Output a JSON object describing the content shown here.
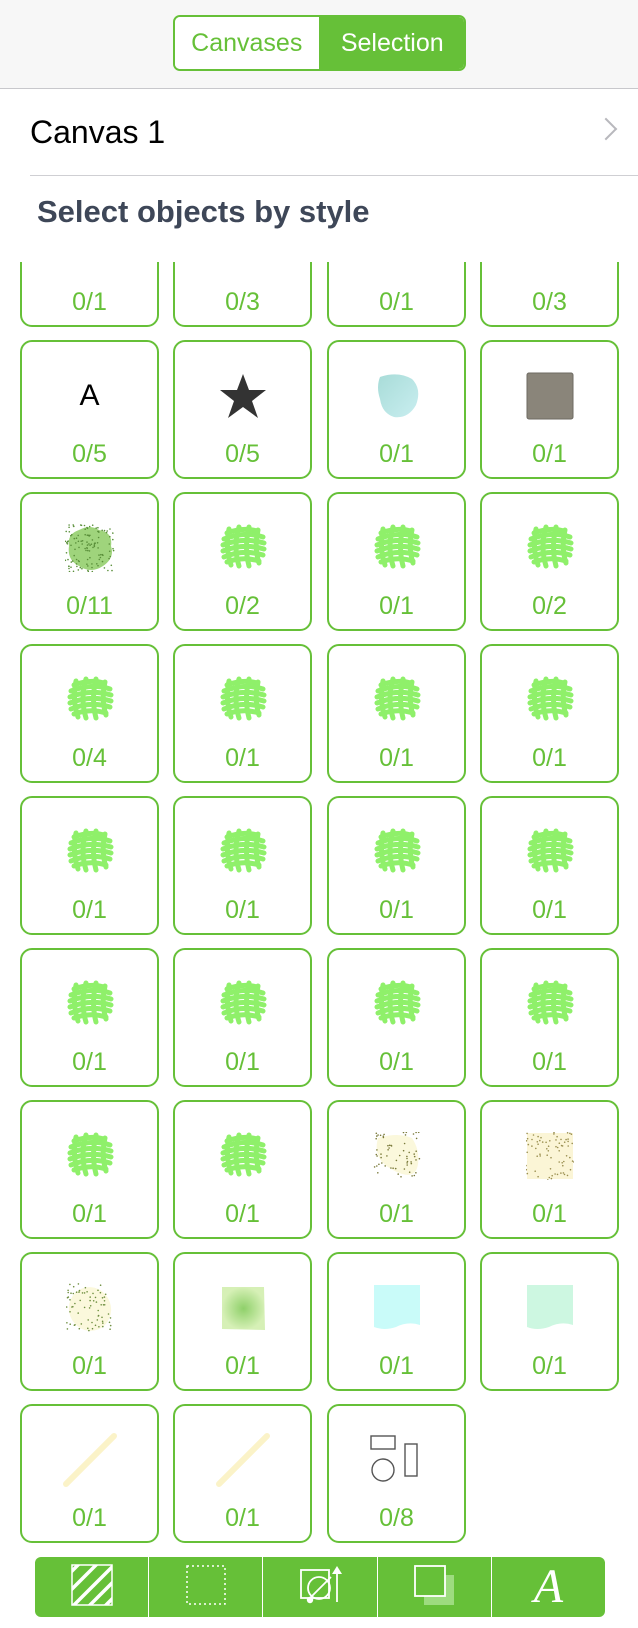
{
  "segmented_control": {
    "left_label": "Canvases",
    "right_label": "Selection",
    "selected": "Selection"
  },
  "canvas_row": {
    "label": "Canvas 1"
  },
  "section": {
    "title": "Select objects by style"
  },
  "colors": {
    "accent": "#66c038",
    "scribble": "#8ff06a",
    "text": "#3e4758"
  },
  "tiles": [
    {
      "icon": "none",
      "count": "0/1"
    },
    {
      "icon": "none",
      "count": "0/3"
    },
    {
      "icon": "none",
      "count": "0/1"
    },
    {
      "icon": "none",
      "count": "0/3"
    },
    {
      "icon": "text-style-icon",
      "glyph": "A",
      "count": "0/5"
    },
    {
      "icon": "star-icon",
      "count": "0/5"
    },
    {
      "icon": "cyan-blob-icon",
      "count": "0/1"
    },
    {
      "icon": "gray-square-icon",
      "count": "0/1"
    },
    {
      "icon": "textured-green-blob-icon",
      "count": "0/11"
    },
    {
      "icon": "green-scribble-icon",
      "count": "0/2"
    },
    {
      "icon": "green-scribble-icon",
      "count": "0/1"
    },
    {
      "icon": "green-scribble-icon",
      "count": "0/2"
    },
    {
      "icon": "green-scribble-icon",
      "count": "0/4"
    },
    {
      "icon": "green-scribble-icon",
      "count": "0/1"
    },
    {
      "icon": "green-scribble-icon",
      "count": "0/1"
    },
    {
      "icon": "green-scribble-icon",
      "count": "0/1"
    },
    {
      "icon": "green-scribble-icon",
      "count": "0/1"
    },
    {
      "icon": "green-scribble-icon",
      "count": "0/1"
    },
    {
      "icon": "green-scribble-icon",
      "count": "0/1"
    },
    {
      "icon": "green-scribble-icon",
      "count": "0/1"
    },
    {
      "icon": "green-scribble-icon",
      "count": "0/1"
    },
    {
      "icon": "green-scribble-icon",
      "count": "0/1"
    },
    {
      "icon": "green-scribble-icon",
      "count": "0/1"
    },
    {
      "icon": "green-scribble-icon",
      "count": "0/1"
    },
    {
      "icon": "green-scribble-icon",
      "count": "0/1"
    },
    {
      "icon": "green-scribble-icon",
      "count": "0/1"
    },
    {
      "icon": "speckled-blob-icon",
      "count": "0/1"
    },
    {
      "icon": "speckled-square-icon",
      "count": "0/1"
    },
    {
      "icon": "speckled-oval-icon",
      "count": "0/1"
    },
    {
      "icon": "gradient-square-icon",
      "count": "0/1"
    },
    {
      "icon": "light-cyan-wave-square-icon",
      "count": "0/1"
    },
    {
      "icon": "mint-wave-square-icon",
      "count": "0/1"
    },
    {
      "icon": "yellow-line-icon",
      "count": "0/1"
    },
    {
      "icon": "yellow-line-icon",
      "count": "0/1"
    },
    {
      "icon": "shapes-group-icon",
      "count": "0/8"
    }
  ],
  "toolbar": [
    {
      "icon": "fill-hatch-icon"
    },
    {
      "icon": "stroke-dotted-icon"
    },
    {
      "icon": "geometry-icon"
    },
    {
      "icon": "shadow-icon"
    },
    {
      "icon": "font-icon",
      "glyph": "A"
    }
  ]
}
